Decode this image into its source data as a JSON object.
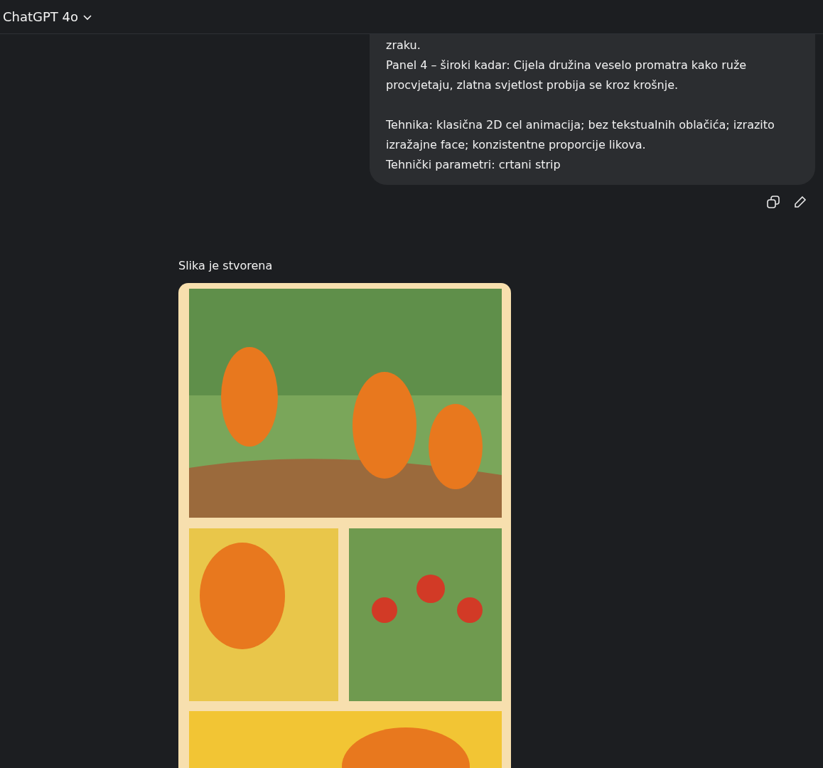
{
  "header": {
    "model_label": "ChatGPT 4o"
  },
  "user_message": {
    "paragraphs": [
      [
        "zraku.",
        "Panel 4 – široki kadar: Cijela družina veselo promatra kako ruže procvjetaju, zlatna svjetlost probija se kroz krošnje."
      ],
      [
        "Tehnika: klasična 2D cel animacija; bez tekstualnih oblačića; izrazito izražajne face; konzistentne proporcije likova.",
        "Tehnički parametri: crtani strip"
      ]
    ]
  },
  "assistant_message": {
    "status": "Slika je stvorena"
  }
}
